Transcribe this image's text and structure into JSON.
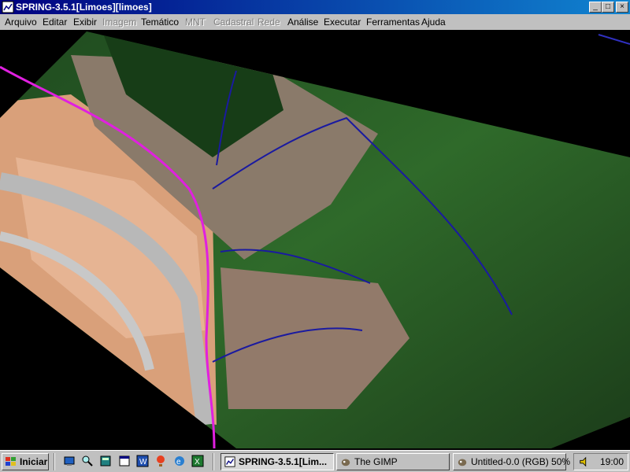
{
  "window": {
    "title": "SPRING-3.5.1[Limoes][limoes]",
    "buttons": {
      "minimize": "_",
      "maximize": "□",
      "close": "×"
    }
  },
  "menu": [
    {
      "label": "Arquivo",
      "enabled": true
    },
    {
      "label": "Editar",
      "enabled": true
    },
    {
      "label": "Exibir",
      "enabled": true
    },
    {
      "label": "Imagem",
      "enabled": false
    },
    {
      "label": "Temático",
      "enabled": true
    },
    {
      "label": "MNT",
      "enabled": false
    },
    {
      "label": "Cadastral",
      "enabled": false
    },
    {
      "label": "Rede",
      "enabled": false
    },
    {
      "label": "Análise",
      "enabled": true
    },
    {
      "label": "Executar",
      "enabled": true
    },
    {
      "label": "Ferramentas",
      "enabled": true
    },
    {
      "label": "Ajuda",
      "enabled": true
    }
  ],
  "canvas": {
    "background": "#000000",
    "layers": {
      "boundary_line_color": "#e020e0",
      "drainage_color": "#1a1aa0"
    }
  },
  "taskbar": {
    "start_label": "Iniciar",
    "quick_launch": [
      "desktop-icon",
      "find-icon",
      "calculator-icon",
      "calendar-icon",
      "word-icon",
      "balloon-icon",
      "ie-icon",
      "excel-icon"
    ],
    "tasks": [
      {
        "label": "SPRING-3.5.1[Lim...",
        "active": true
      },
      {
        "label": "The GIMP",
        "active": false
      },
      {
        "label": "Untitled-0.0 (RGB) 50%",
        "active": false
      }
    ],
    "clock": "19:00"
  }
}
